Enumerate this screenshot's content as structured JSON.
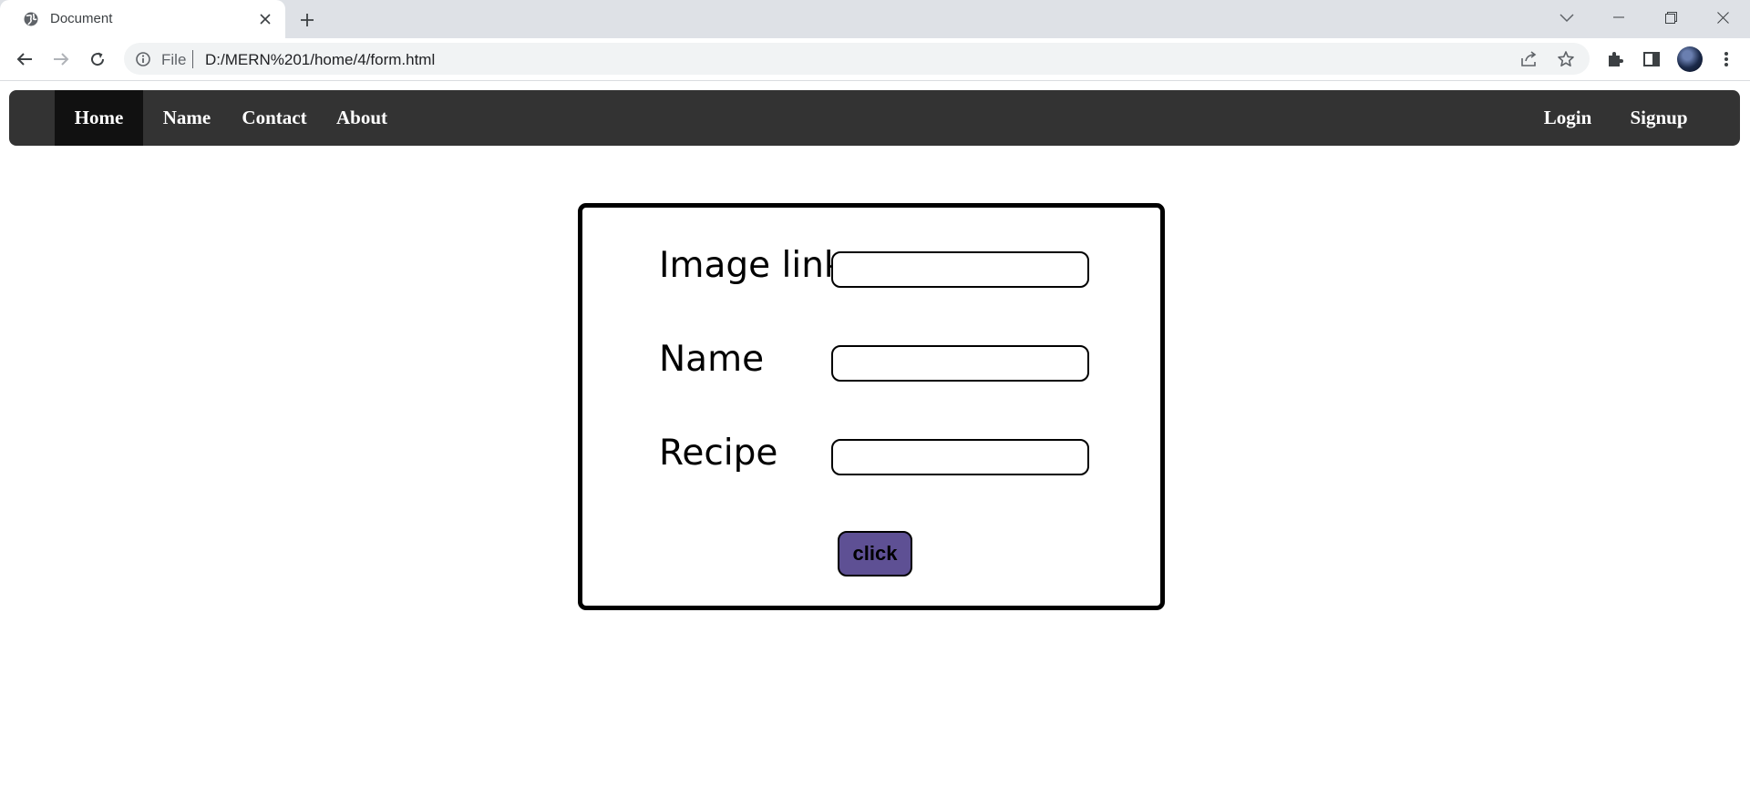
{
  "browser": {
    "tab_title": "Document",
    "address_scheme": "File",
    "address_url": "D:/MERN%201/home/4/form.html",
    "icons": {
      "favicon": "globe-icon",
      "tab_close": "close-icon",
      "new_tab": "plus-icon",
      "tab_search": "chevron-down-icon",
      "back": "arrow-left-icon",
      "forward": "arrow-right-icon",
      "reload": "reload-icon",
      "site_info": "info-icon",
      "share": "share-icon",
      "bookmark": "star-icon",
      "extensions": "puzzle-icon",
      "side_panel": "side-panel-icon",
      "menu": "kebab-menu-icon",
      "window_min": "minimize-icon",
      "window_max": "restore-icon",
      "window_close": "close-icon"
    }
  },
  "navbar": {
    "left_links": [
      {
        "label": "Home",
        "active": true
      },
      {
        "label": "Name",
        "active": false
      },
      {
        "label": "Contact",
        "active": false
      },
      {
        "label": "About",
        "active": false
      }
    ],
    "right_links": [
      {
        "label": "Login"
      },
      {
        "label": "Signup"
      }
    ],
    "background": "#333333",
    "active_background": "#111111"
  },
  "form": {
    "fields": [
      {
        "label": "Image link",
        "value": "",
        "placeholder": ""
      },
      {
        "label": "Name",
        "value": "",
        "placeholder": ""
      },
      {
        "label": "Recipe",
        "value": "",
        "placeholder": ""
      }
    ],
    "submit_label": "click",
    "submit_color": "#5e5094"
  }
}
